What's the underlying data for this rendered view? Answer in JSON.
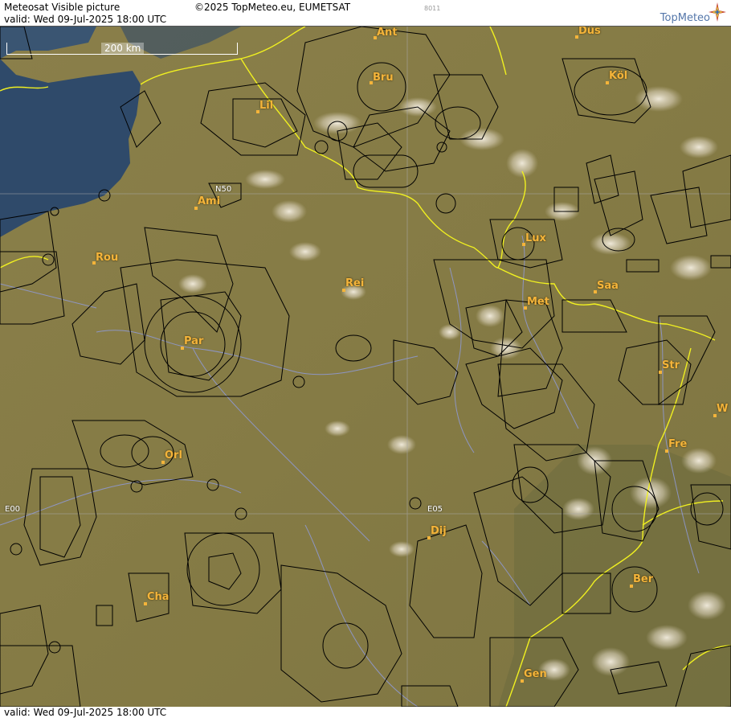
{
  "header": {
    "title": "Meteosat Visible picture",
    "valid": "valid:  Wed  09-Jul-2025  18:00 UTC",
    "copyright": "©2025 TopMeteo.eu, EUMETSAT",
    "code": "8011",
    "brand": "TopMeteo"
  },
  "footer": {
    "valid": "valid:  Wed  09-Jul-2025  18:00 UTC"
  },
  "map": {
    "scale_label": "200 km",
    "grid_labels": {
      "n50": "N50",
      "e00": "E00",
      "e05": "E05"
    },
    "cities": {
      "ant": "Ant",
      "dus": "Düs",
      "bru": "Bru",
      "kol": "Köl",
      "lil": "Lil",
      "ami": "Ami",
      "lux": "Lux",
      "rou": "Rou",
      "rei": "Rei",
      "saa": "Saa",
      "met": "Met",
      "par": "Par",
      "str": "Str",
      "w": "W",
      "fre": "Fre",
      "orl": "Orl",
      "dij": "Dij",
      "ber": "Ber",
      "cha": "Cha",
      "gen": "Gen"
    },
    "colors": {
      "land": "#8a8048",
      "sea": "#2f4a6a",
      "border": "#f0f020",
      "river": "#8f9ad8",
      "airspace": "#000000",
      "city": "#f4b43a"
    }
  }
}
